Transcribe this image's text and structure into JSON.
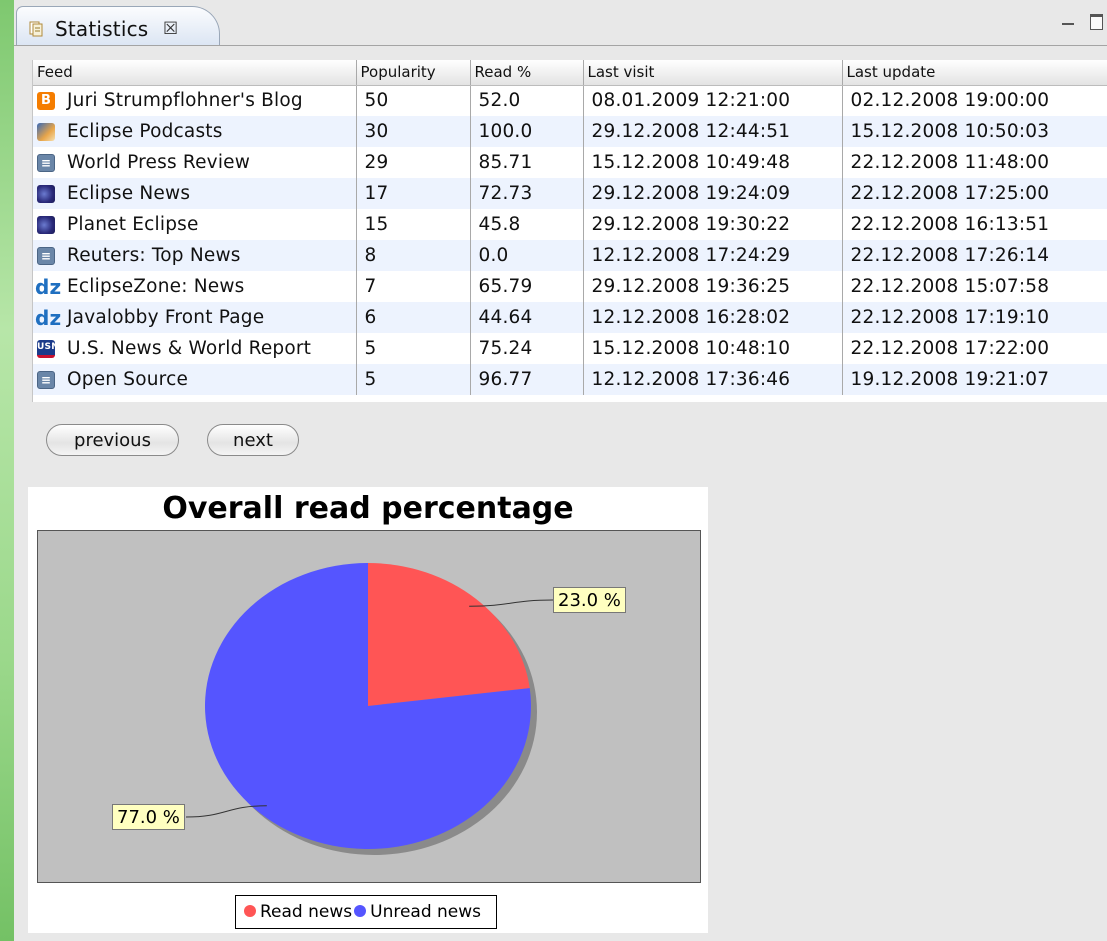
{
  "tab": {
    "title": "Statistics",
    "icon": "document-icon"
  },
  "table": {
    "columns": [
      "Feed",
      "Popularity",
      "Read %",
      "Last visit",
      "Last update"
    ],
    "rows": [
      {
        "icon": "blogger",
        "feed": "Juri Strumpflohner's Blog",
        "popularity": "50",
        "read": "52.0",
        "last_visit": "08.01.2009 12:21:00",
        "last_update": "02.12.2008 19:00:00"
      },
      {
        "icon": "podcast",
        "feed": "Eclipse Podcasts",
        "popularity": "30",
        "read": "100.0",
        "last_visit": "29.12.2008 12:44:51",
        "last_update": "15.12.2008 10:50:03"
      },
      {
        "icon": "rss",
        "feed": "World Press Review",
        "popularity": "29",
        "read": "85.71",
        "last_visit": "15.12.2008 10:49:48",
        "last_update": "22.12.2008 11:48:00"
      },
      {
        "icon": "eclipse",
        "feed": "Eclipse News",
        "popularity": "17",
        "read": "72.73",
        "last_visit": "29.12.2008 19:24:09",
        "last_update": "22.12.2008 17:25:00"
      },
      {
        "icon": "eclipse",
        "feed": "Planet Eclipse",
        "popularity": "15",
        "read": "45.8",
        "last_visit": "29.12.2008 19:30:22",
        "last_update": "22.12.2008 16:13:51"
      },
      {
        "icon": "rss",
        "feed": "Reuters: Top News",
        "popularity": "8",
        "read": "0.0",
        "last_visit": "12.12.2008 17:24:29",
        "last_update": "22.12.2008 17:26:14"
      },
      {
        "icon": "dz",
        "feed": "EclipseZone: News",
        "popularity": "7",
        "read": "65.79",
        "last_visit": "29.12.2008 19:36:25",
        "last_update": "22.12.2008 15:07:58"
      },
      {
        "icon": "dz",
        "feed": "Javalobby Front Page",
        "popularity": "6",
        "read": "44.64",
        "last_visit": "12.12.2008 16:28:02",
        "last_update": "22.12.2008 17:19:10"
      },
      {
        "icon": "usn",
        "feed": "U.S. News & World Report",
        "popularity": "5",
        "read": "75.24",
        "last_visit": "15.12.2008 10:48:10",
        "last_update": "22.12.2008 17:22:00"
      },
      {
        "icon": "rss",
        "feed": "Open Source",
        "popularity": "5",
        "read": "96.77",
        "last_visit": "12.12.2008 17:36:46",
        "last_update": "19.12.2008 19:21:07"
      }
    ]
  },
  "buttons": {
    "previous": "previous",
    "next": "next"
  },
  "chart_data": {
    "type": "pie",
    "title": "Overall read percentage",
    "slices": [
      {
        "name": "Read news",
        "value": 23.0,
        "label": "23.0 %",
        "color": "#ff5555"
      },
      {
        "name": "Unread news",
        "value": 77.0,
        "label": "77.0 %",
        "color": "#5555ff"
      }
    ],
    "legend": [
      "Read news",
      "Unread news"
    ],
    "legend_position": "bottom",
    "plot_background": "#c0c0c0"
  }
}
